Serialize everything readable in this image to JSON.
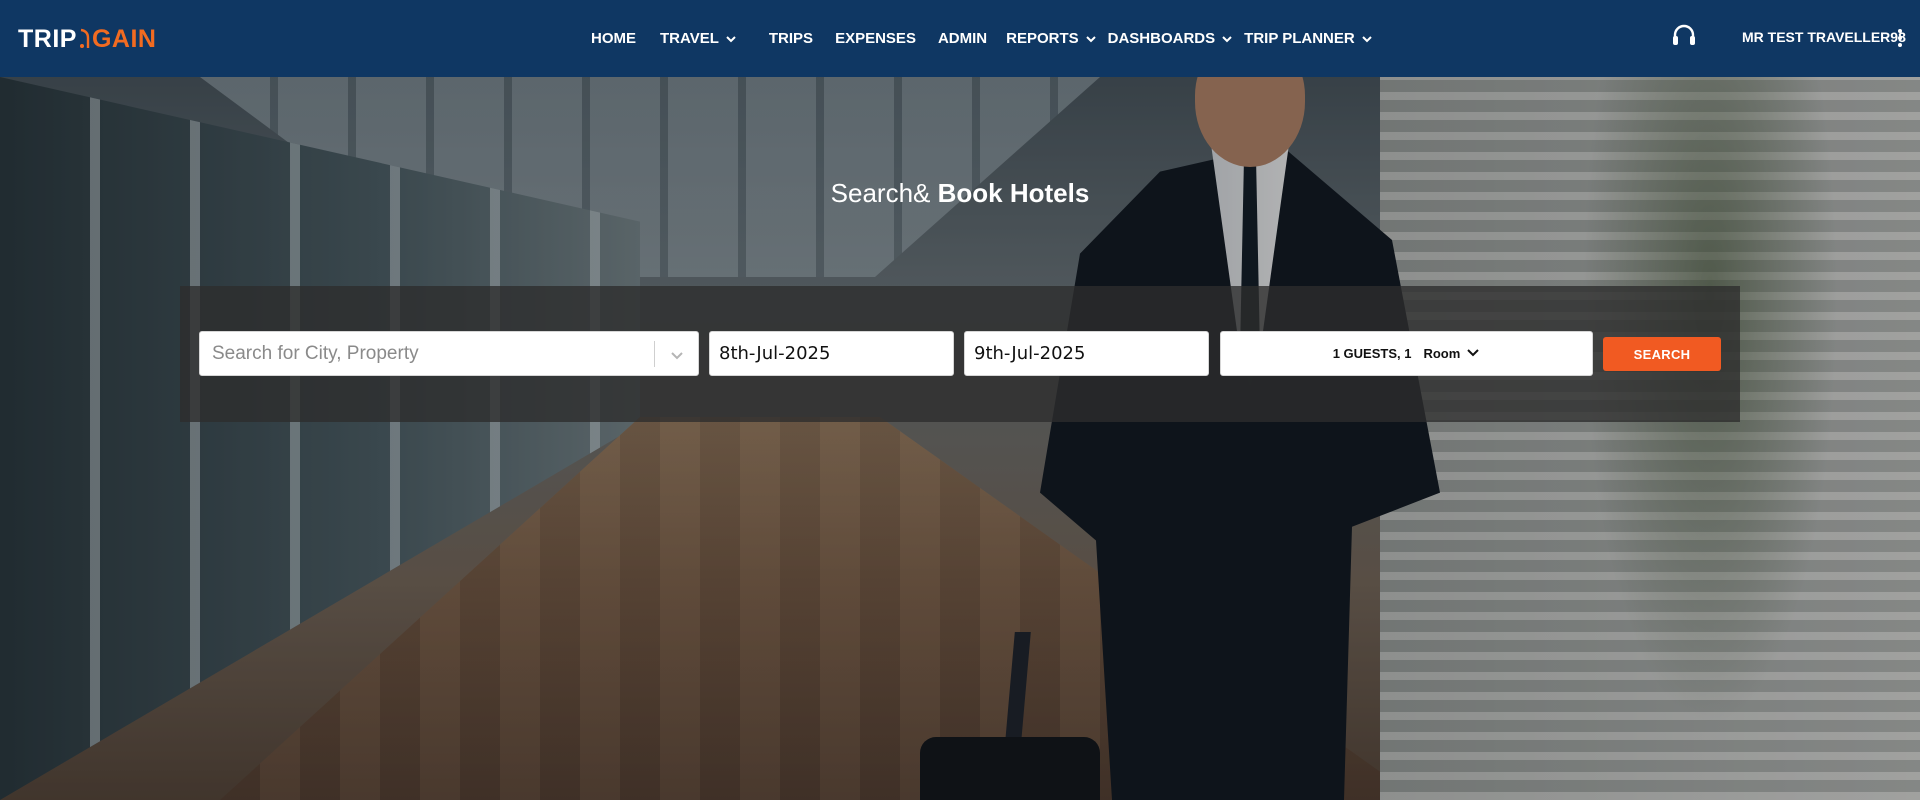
{
  "brand": {
    "logo_left": "TRIP",
    "logo_right": "GAIN",
    "accent_color": "#f26b21",
    "header_bg": "#0f3763"
  },
  "nav": {
    "items": [
      {
        "label": "HOME",
        "has_dropdown": false
      },
      {
        "label": "TRAVEL",
        "has_dropdown": true
      },
      {
        "label": "TRIPS",
        "has_dropdown": false
      },
      {
        "label": "EXPENSES",
        "has_dropdown": false
      },
      {
        "label": "ADMIN",
        "has_dropdown": false
      },
      {
        "label": "REPORTS",
        "has_dropdown": true
      },
      {
        "label": "DASHBOARDS",
        "has_dropdown": true
      },
      {
        "label": "TRIP PLANNER",
        "has_dropdown": true
      }
    ]
  },
  "header_right": {
    "support_icon": "headset-icon",
    "user_name": "MR TEST TRAVELLER98",
    "menu_icon": "kebab-icon"
  },
  "hero": {
    "title_light": "Search& ",
    "title_bold": "Book Hotels"
  },
  "search": {
    "city_placeholder": "Search for City, Property",
    "checkin": "8th-Jul-2025",
    "checkout": "9th-Jul-2025",
    "guests_label": "1 GUESTS, 1",
    "room_label": "Room",
    "button_label": "SEARCH",
    "button_color": "#f15a22"
  }
}
